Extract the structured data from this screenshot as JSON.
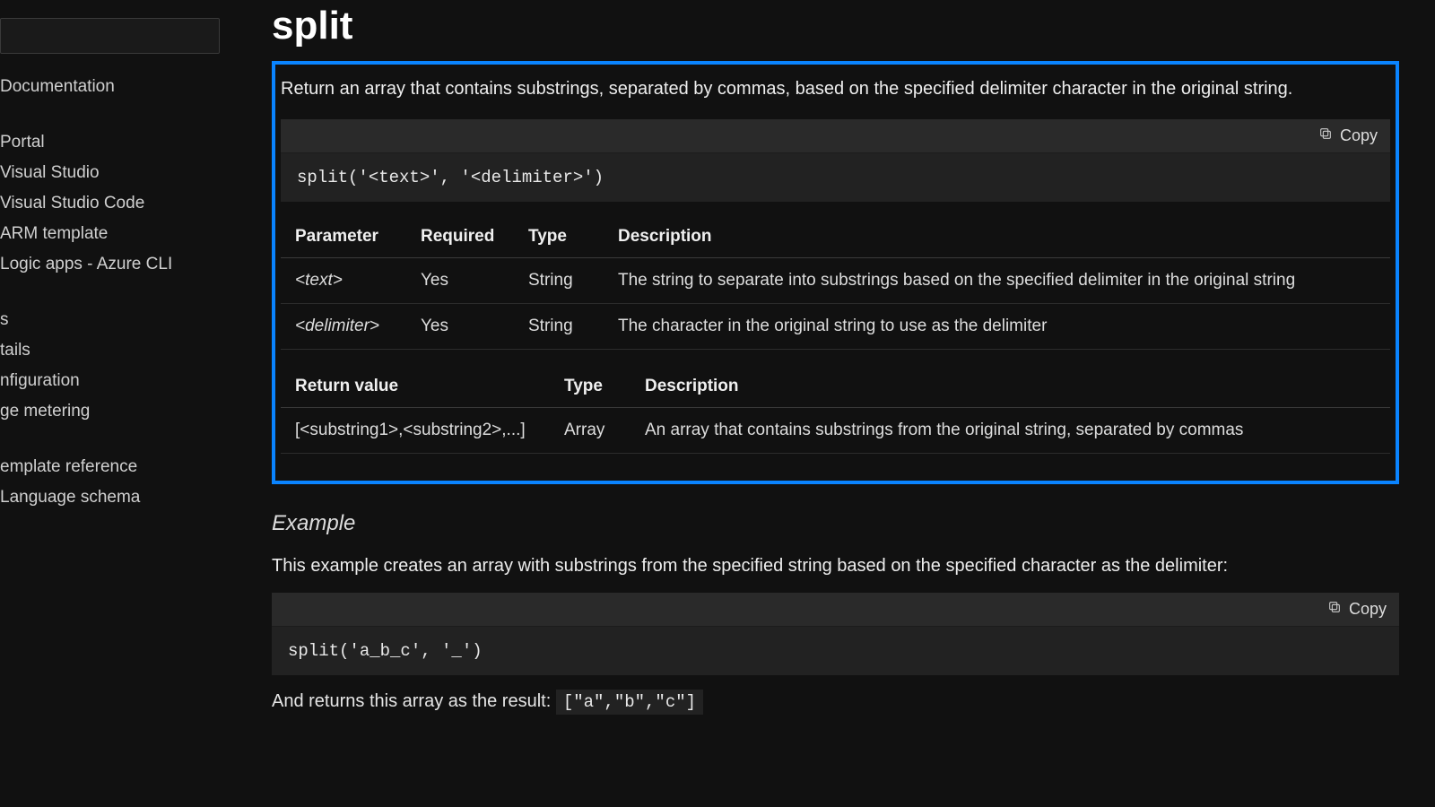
{
  "sidebar": {
    "groups": [
      {
        "items": [
          {
            "label": "Documentation"
          }
        ]
      },
      {
        "items": [
          {
            "label": "Portal"
          },
          {
            "label": "Visual Studio"
          },
          {
            "label": "Visual Studio Code"
          },
          {
            "label": "ARM template"
          },
          {
            "label": "Logic apps - Azure CLI"
          }
        ]
      },
      {
        "items": [
          {
            "label": "s"
          },
          {
            "label": "tails"
          },
          {
            "label": "nfiguration"
          },
          {
            "label": "ge metering"
          }
        ]
      },
      {
        "items": [
          {
            "label": "emplate reference"
          },
          {
            "label": "Language schema"
          }
        ]
      }
    ]
  },
  "page": {
    "title": "split",
    "lead": "Return an array that contains substrings, separated by commas, based on the specified delimiter character in the original string.",
    "copy_label": "Copy",
    "syntax_code": "split('<text>', '<delimiter>')",
    "param_table": {
      "headers": [
        "Parameter",
        "Required",
        "Type",
        "Description"
      ],
      "rows": [
        {
          "name": "<text>",
          "required": "Yes",
          "type": "String",
          "desc": "The string to separate into substrings based on the specified delimiter in the original string"
        },
        {
          "name": "<delimiter>",
          "required": "Yes",
          "type": "String",
          "desc": "The character in the original string to use as the delimiter"
        }
      ]
    },
    "return_table": {
      "headers": [
        "Return value",
        "Type",
        "Description"
      ],
      "rows": [
        {
          "value": "[<substring1>,<substring2>,...]",
          "type": "Array",
          "desc": "An array that contains substrings from the original string, separated by commas"
        }
      ]
    },
    "example": {
      "heading": "Example",
      "text": "This example creates an array with substrings from the specified string based on the specified character as the delimiter:",
      "code": "split('a_b_c', '_')",
      "result_prefix": "And returns this array as the result: ",
      "result_code": "[\"a\",\"b\",\"c\"]"
    }
  }
}
